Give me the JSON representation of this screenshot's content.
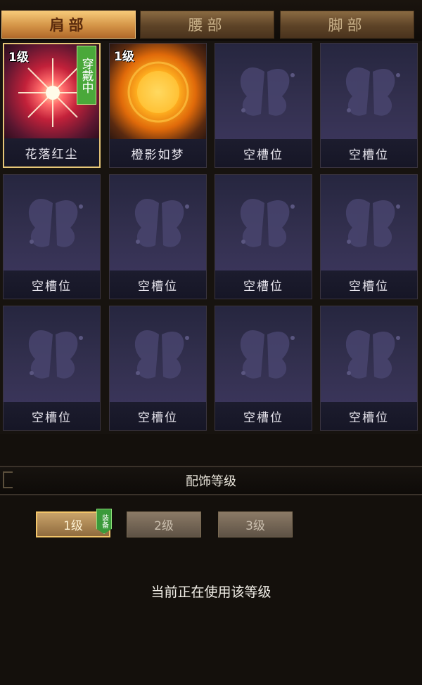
{
  "tabs": [
    {
      "label": "肩部",
      "active": true
    },
    {
      "label": "腰部",
      "active": false
    },
    {
      "label": "脚部",
      "active": false
    }
  ],
  "slots": [
    {
      "name": "花落红尘",
      "level": "1级",
      "wearing": "穿戴中",
      "icon": "red-star-burst-icon"
    },
    {
      "name": "橙影如梦",
      "level": "1级",
      "icon": "orange-sun-icon"
    },
    {
      "name": "空槽位",
      "icon": "butterfly-placeholder-icon"
    },
    {
      "name": "空槽位",
      "icon": "butterfly-placeholder-icon"
    },
    {
      "name": "空槽位",
      "icon": "butterfly-placeholder-icon"
    },
    {
      "name": "空槽位",
      "icon": "butterfly-placeholder-icon"
    },
    {
      "name": "空槽位",
      "icon": "butterfly-placeholder-icon"
    },
    {
      "name": "空槽位",
      "icon": "butterfly-placeholder-icon"
    },
    {
      "name": "空槽位",
      "icon": "butterfly-placeholder-icon"
    },
    {
      "name": "空槽位",
      "icon": "butterfly-placeholder-icon"
    },
    {
      "name": "空槽位",
      "icon": "butterfly-placeholder-icon"
    },
    {
      "name": "空槽位",
      "icon": "butterfly-placeholder-icon"
    }
  ],
  "section": {
    "title": "配饰等级"
  },
  "levels": [
    {
      "label": "1级",
      "active": true,
      "badge": "装备"
    },
    {
      "label": "2级",
      "active": false
    },
    {
      "label": "3级",
      "active": false
    }
  ],
  "status": "当前正在使用该等级",
  "colors": {
    "active_tab": "#d39346",
    "selected_border": "#e6c677",
    "wearing_badge": "#4aa83a",
    "slot_bg": "#2b2a45"
  }
}
